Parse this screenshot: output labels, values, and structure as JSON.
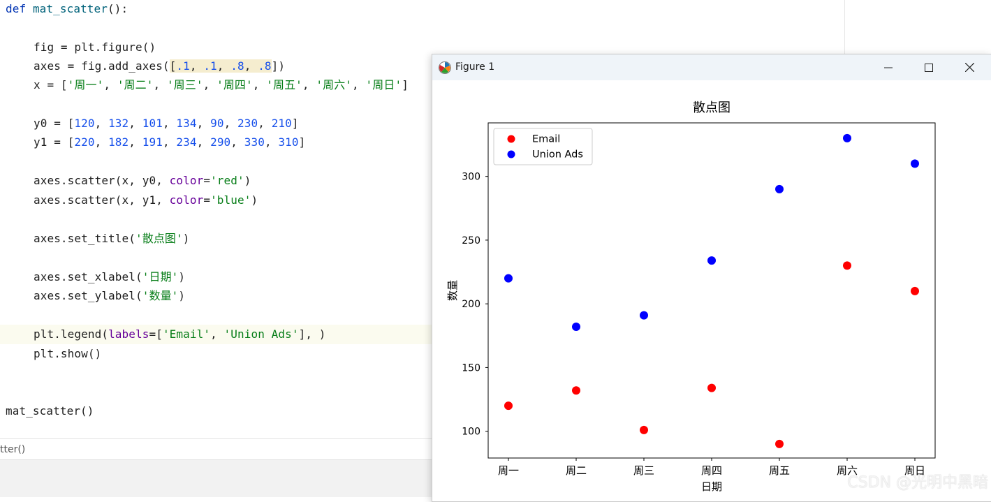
{
  "editor": {
    "line_def": {
      "kw": "def",
      "name": "mat_scatter",
      "rest": "():"
    },
    "line_fig": "fig = plt.figure()",
    "line_axes": {
      "pre": "axes = fig.add_axes(",
      "open": "[",
      "n1": ".1",
      "n2": ".1",
      "n3": ".8",
      "n4": ".8",
      "close": "]",
      "post": ")"
    },
    "line_x": {
      "pre": "x = [",
      "items": [
        "'周一'",
        "'周二'",
        "'周三'",
        "'周四'",
        "'周五'",
        "'周六'",
        "'周日'"
      ],
      "post": "]"
    },
    "line_y0": {
      "pre": "y0 = [",
      "nums": [
        "120",
        "132",
        "101",
        "134",
        "90",
        "230",
        "210"
      ],
      "post": "]"
    },
    "line_y1": {
      "pre": "y1 = [",
      "nums": [
        "220",
        "182",
        "191",
        "234",
        "290",
        "330",
        "310"
      ],
      "post": "]"
    },
    "line_sc0": {
      "pre": "axes.scatter(x, y0, ",
      "param": "color",
      "eq": "=",
      "val": "'red'",
      "post": ")"
    },
    "line_sc1": {
      "pre": "axes.scatter(x, y1, ",
      "param": "color",
      "eq": "=",
      "val": "'blue'",
      "post": ")"
    },
    "line_title": {
      "pre": "axes.set_title(",
      "val": "'散点图'",
      "post": ")"
    },
    "line_xlabel": {
      "pre": "axes.set_xlabel(",
      "val": "'日期'",
      "post": ")"
    },
    "line_ylabel": {
      "pre": "axes.set_ylabel(",
      "val": "'数量'",
      "post": ")"
    },
    "line_legend": {
      "pre": "plt.legend(",
      "param": "labels",
      "eq": "=[",
      "v1": "'Email'",
      "sep": ", ",
      "v2": "'Union Ads'",
      "post": "], )"
    },
    "line_show": "plt.show()",
    "line_call": "mat_scatter()"
  },
  "breadcrumb": "tter()",
  "window": {
    "title": "Figure 1"
  },
  "watermark": "CSDN @光明中黑暗",
  "chart_data": {
    "type": "scatter",
    "title": "散点图",
    "xlabel": "日期",
    "ylabel": "数量",
    "categories": [
      "周一",
      "周二",
      "周三",
      "周四",
      "周五",
      "周六",
      "周日"
    ],
    "series": [
      {
        "name": "Email",
        "color": "#ff0000",
        "values": [
          120,
          132,
          101,
          134,
          90,
          230,
          210
        ]
      },
      {
        "name": "Union Ads",
        "color": "#0000ff",
        "values": [
          220,
          182,
          191,
          234,
          290,
          330,
          310
        ]
      }
    ],
    "yticks": [
      100,
      150,
      200,
      250,
      300
    ],
    "ylim": [
      79,
      342
    ],
    "legend": "upper-left",
    "grid": false
  }
}
